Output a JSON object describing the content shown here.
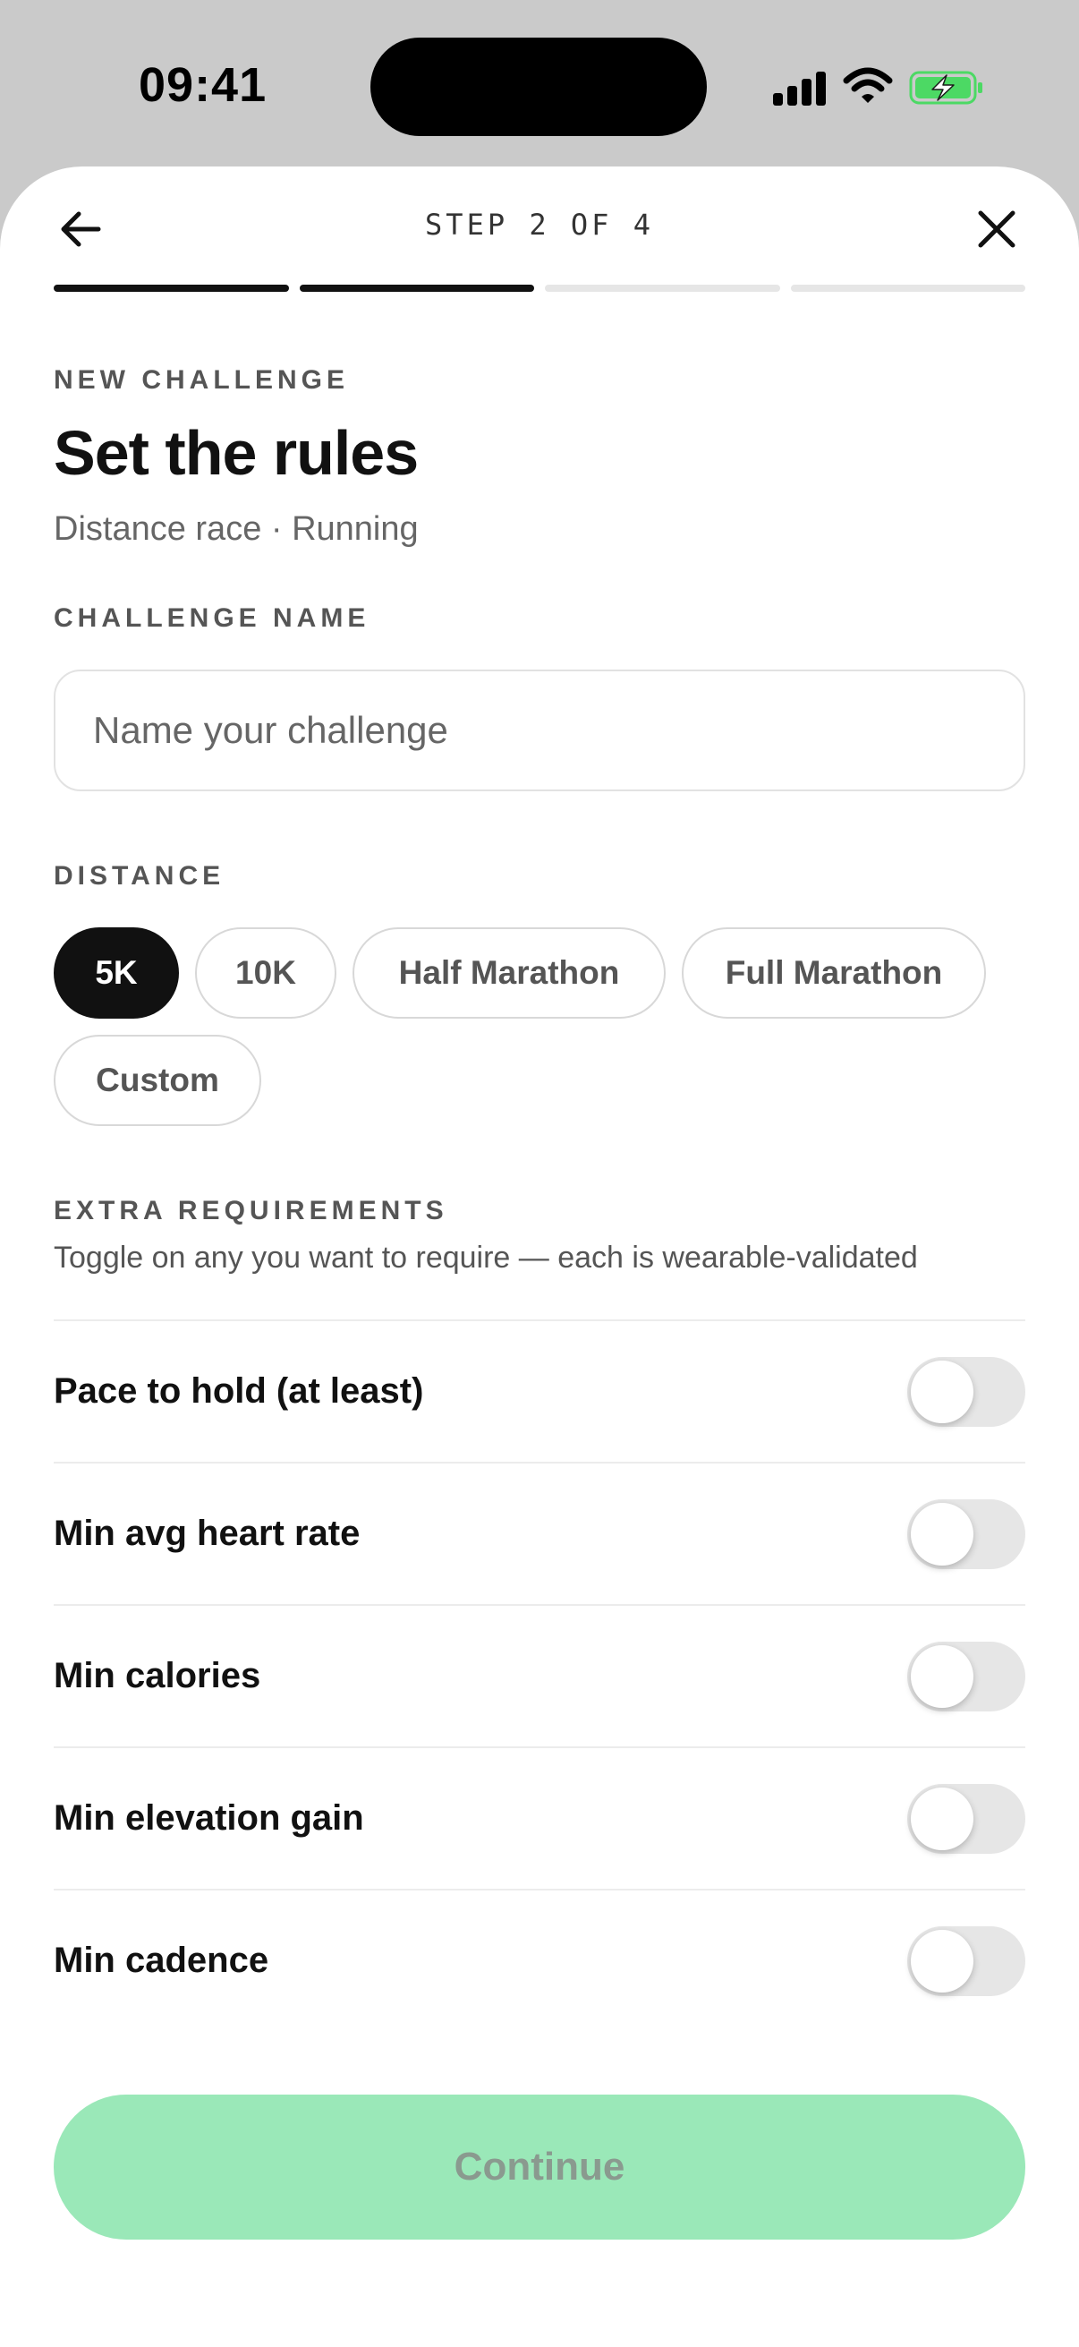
{
  "status_bar": {
    "time": "09:41",
    "icons": [
      "signal-icon",
      "wifi-icon",
      "battery-charging-icon"
    ]
  },
  "header": {
    "step_label": "STEP 2 OF 4",
    "progress": {
      "current": 2,
      "total": 4
    },
    "back_icon": "arrow-left-icon",
    "close_icon": "close-icon"
  },
  "intro": {
    "eyebrow": "NEW CHALLENGE",
    "title": "Set the rules",
    "subtitle": "Distance race · Running"
  },
  "name_field": {
    "label": "CHALLENGE NAME",
    "placeholder": "Name your challenge",
    "value": ""
  },
  "distance": {
    "label": "DISTANCE",
    "options": [
      "5K",
      "10K",
      "Half Marathon",
      "Full Marathon",
      "Custom"
    ],
    "selected": "5K"
  },
  "requirements": {
    "label": "EXTRA REQUIREMENTS",
    "helper": "Toggle on any you want to require — each is wearable-validated",
    "items": [
      {
        "label": "Pace to hold (at least)",
        "enabled": false
      },
      {
        "label": "Min avg heart rate",
        "enabled": false
      },
      {
        "label": "Min calories",
        "enabled": false
      },
      {
        "label": "Min elevation gain",
        "enabled": false
      },
      {
        "label": "Min cadence",
        "enabled": false
      }
    ]
  },
  "footer": {
    "continue_label": "Continue",
    "disabled": true
  },
  "colors": {
    "accent_disabled": "#9ae8b8",
    "selected_chip": "#111111",
    "battery_green": "#4cd964"
  }
}
